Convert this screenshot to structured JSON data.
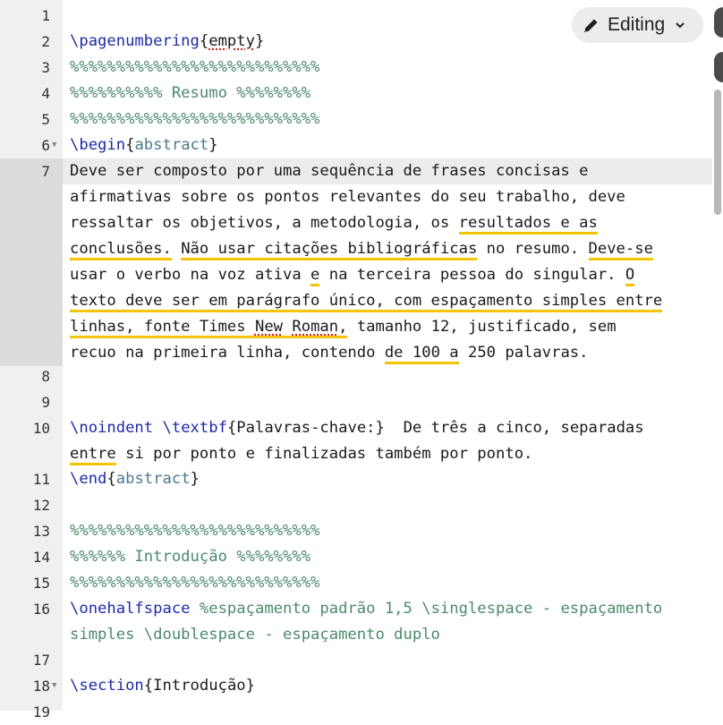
{
  "editor": {
    "mode_label": "Editing",
    "line_numbers": [
      "1",
      "2",
      "3",
      "4",
      "5",
      "6",
      "7",
      "8",
      "9",
      "10",
      "11",
      "12",
      "13",
      "14",
      "15",
      "16",
      "17",
      "18",
      "19"
    ],
    "lines": {
      "l2": {
        "cmd": "\\pagenumbering",
        "brace_open": "{",
        "arg": "empty",
        "brace_close": "}"
      },
      "l3": "%%%%%%%%%%%%%%%%%%%%%%%%%%%",
      "l4": "%%%%%%%%%% Resumo %%%%%%%%",
      "l5": "%%%%%%%%%%%%%%%%%%%%%%%%%%%",
      "l6": {
        "cmd": "\\begin",
        "brace_open": "{",
        "arg": "abstract",
        "brace_close": "}"
      },
      "l7": [
        "Deve ser composto por uma sequência de frases concisas e",
        "afirmativas sobre os pontos relevantes do seu trabalho, deve",
        "ressaltar os objetivos, a metodologia, os ",
        "resultados e as",
        "conclusões.",
        " ",
        "Não usar citações bibliográficas",
        " no resumo. ",
        "Deve-se",
        "usar o verbo na voz ativa ",
        "e",
        " na terceira pessoa do singular. ",
        "O",
        "texto deve ser em parágrafo único, com espaçamento simples entre",
        "linhas, fonte Times ",
        "New",
        " ",
        "Roman",
        ",",
        " tamanho 12, justificado, sem",
        "recuo na primeira linha, contendo ",
        "de 100 a",
        " 250 palavras."
      ],
      "l10": {
        "cmd1": "\\noindent",
        "cmd2": "\\textbf",
        "brace_open": "{",
        "arg": "Palavras-chave:",
        "brace_close": "}",
        "text": "  De três a cinco, separadas",
        "wrap_u": "entre",
        "wrap_rest": " si por ponto e finalizadas também por ponto."
      },
      "l11": {
        "cmd": "\\end",
        "brace_open": "{",
        "arg": "abstract",
        "brace_close": "}"
      },
      "l13": "%%%%%%%%%%%%%%%%%%%%%%%%%%%",
      "l14": "%%%%%% Introdução %%%%%%%%",
      "l15": "%%%%%%%%%%%%%%%%%%%%%%%%%%%",
      "l16": {
        "cmd": "\\onehalfspace",
        "comment1": " %espaçamento padrão 1,5 \\singlespace - espaçamento",
        "comment2": "simples \\doublespace - espaçamento duplo"
      },
      "l18": {
        "cmd": "\\section",
        "brace_open": "{",
        "arg": "Introdução",
        "brace_close": "}"
      }
    }
  },
  "colors": {
    "command": "#1f2aa8",
    "argument": "#4a7a8c",
    "comment": "#4a8a6b",
    "grammar_underline": "#f4c400",
    "spelling_underline": "#d02020"
  },
  "icons": {
    "mode": "pencil-icon",
    "dropdown": "chevron-down-icon",
    "fold": "fold-arrow-icon"
  }
}
